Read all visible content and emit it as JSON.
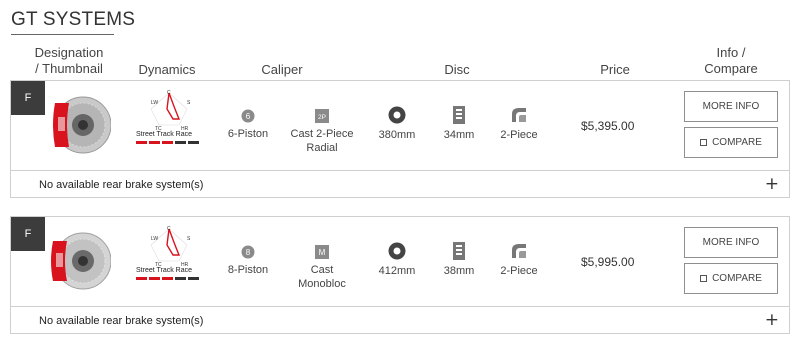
{
  "section": {
    "title": "GT SYSTEMS"
  },
  "columns": {
    "designation_line1": "Designation",
    "designation_line2": "/ Thumbnail",
    "dynamics": "Dynamics",
    "caliper": "Caliper",
    "disc": "Disc",
    "price": "Price",
    "info_line1": "Info /",
    "info_line2": "Compare"
  },
  "dynamics_labels": {
    "c": "C",
    "lw": "LW",
    "s": "S",
    "tc": "TC",
    "hr": "HR",
    "legend": "Street Track  Race"
  },
  "systems": [
    {
      "position": "F",
      "dynamics_bars": [
        1,
        1,
        1,
        0,
        0
      ],
      "caliper_pistons_icon_text": "6",
      "caliper_pistons": "6-Piston",
      "caliper_type_icon_text": "2P",
      "caliper_type_line1": "Cast 2-Piece",
      "caliper_type_line2": "Radial",
      "disc_diameter": "380mm",
      "disc_thickness": "34mm",
      "disc_type": "2-Piece",
      "price": "$5,395.00",
      "more_info": "MORE INFO",
      "compare": "COMPARE",
      "rear_text": "No available rear brake system(s)",
      "expand": "+"
    },
    {
      "position": "F",
      "dynamics_bars": [
        1,
        1,
        1,
        0,
        0
      ],
      "caliper_pistons_icon_text": "8",
      "caliper_pistons": "8-Piston",
      "caliper_type_icon_text": "M",
      "caliper_type_line1": "Cast",
      "caliper_type_line2": "Monobloc",
      "disc_diameter": "412mm",
      "disc_thickness": "38mm",
      "disc_type": "2-Piece",
      "price": "$5,995.00",
      "more_info": "MORE INFO",
      "compare": "COMPARE",
      "rear_text": "No available rear brake system(s)",
      "expand": "+"
    }
  ],
  "colors": {
    "accent": "#d9131e",
    "dark": "#3c3c3c",
    "border": "#cfcfcf"
  }
}
